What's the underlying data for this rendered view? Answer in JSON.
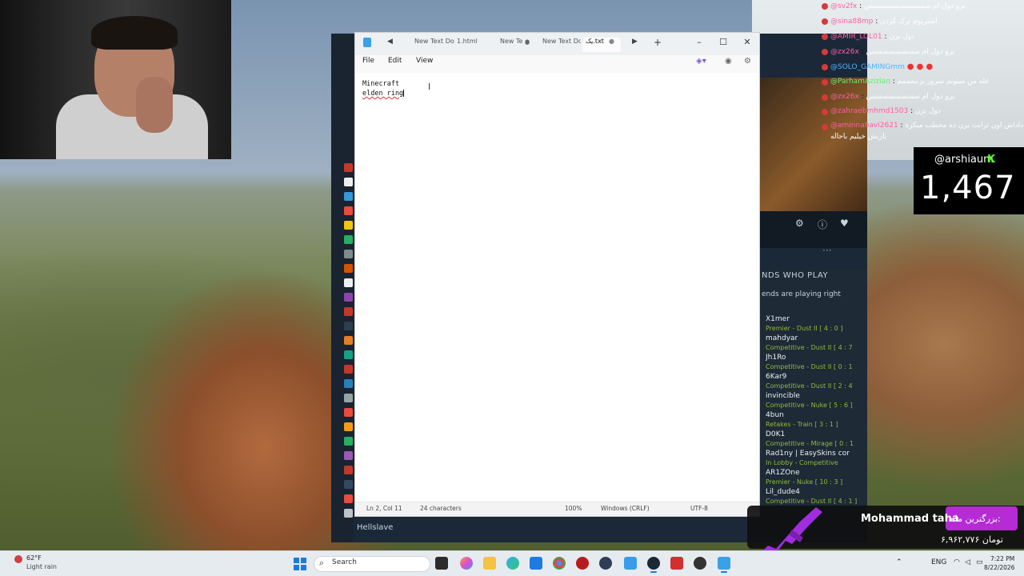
{
  "notepad": {
    "tabs": [
      {
        "label": "New Text Do",
        "modified": false
      },
      {
        "label": "1.html",
        "modified": true
      },
      {
        "label": "New Te",
        "modified": true
      },
      {
        "label": "New Text Do",
        "modified": false
      },
      {
        "label": "یک.txt",
        "modified": true,
        "active": true
      }
    ],
    "add_tab": "+",
    "menu": {
      "file": "File",
      "edit": "Edit",
      "view": "View"
    },
    "lines": [
      "Minecraft",
      "elden ring"
    ],
    "status": {
      "position": "Ln 2, Col 11",
      "characters": "24 characters",
      "zoom": "100%",
      "line_ending": "Windows (CRLF)",
      "encoding": "UTF-8"
    }
  },
  "steam": {
    "friends_title": "NDS WHO PLAY",
    "friends_subtitle": "ends are playing right",
    "bottom_item": "Hellslave",
    "friends": [
      {
        "name": "X1mer",
        "status": "Premier - Dust II [ 4 : 0 ]"
      },
      {
        "name": "mahdyar",
        "status": "Competitive - Dust II [ 4 : 7"
      },
      {
        "name": "Jh1Ro",
        "status": "Competitive - Dust II [ 0 : 1"
      },
      {
        "name": "6Kar9",
        "status": "Competitive - Dust II [ 2 : 4"
      },
      {
        "name": "invincible",
        "status": "Competitive - Nuke [ 5 : 6 ]"
      },
      {
        "name": "4bun",
        "status": "Retakes - Train [ 3 : 1 ]"
      },
      {
        "name": "D0K1",
        "status": "Competitive - Mirage [ 0 : 1"
      },
      {
        "name": "Rad1ny | EasySkins cor",
        "status": "In Lobby - Competitive"
      },
      {
        "name": "AR1ZOne",
        "status": "Premier - Nuke [ 10 : 3 ]"
      },
      {
        "name": "Lil_dude4",
        "status": "Competitive - Dust II [ 4 : 1 ]"
      }
    ]
  },
  "chat": [
    {
      "user": "@sv2fx",
      "msg": "برو دول ام سسسسسسسسسس",
      "color": "#ff5fa2"
    },
    {
      "user": "@sina88mp",
      "msg": "اشتریوم ترک کردن",
      "color": "#ff5fa2"
    },
    {
      "user": "@AMIR_LOL01",
      "msg": "دول بزن",
      "color": "#ff5fa2"
    },
    {
      "user": "@zx26x",
      "msg": "برو دول ام سسسسسسسس",
      "color": "#ff5fa2"
    },
    {
      "user": "@SOLO_GAMINGmm",
      "msg": "",
      "color": "#4fb4ff"
    },
    {
      "user": "@ParhamAzizian",
      "msg": "عله من میتونم سرور بزنیمممم",
      "color": "#63f06f"
    },
    {
      "user": "@zx26x",
      "msg": "برو دول ام سسسسسسسس",
      "color": "#ff5fa2"
    },
    {
      "user": "@zahraebmhmd1503",
      "msg": "دول بزن",
      "color": "#ff5fa2"
    },
    {
      "user": "@aminnabavi2621",
      "msg": "داداش اون ترانت بزن ده مخطب میکره",
      "color": "#ff5fa2"
    },
    {
      "user": "",
      "msg": "بازیش خیلیم باحاله",
      "color": "#ffffff"
    }
  ],
  "counter": {
    "username": "@arshiaum",
    "platform_icon": "K",
    "viewers": "1,467"
  },
  "donation": {
    "donor": "Mohammad taha",
    "title": "بزرگترین ماه:",
    "amount": "۶,۹۶۲,۷۷۶ تومان"
  },
  "taskbar": {
    "weather_temp": "62°F",
    "weather_desc": "Light rain",
    "search_placeholder": "Search",
    "language": "ENG",
    "time": "7:22 PM",
    "date": "8/22/2026"
  },
  "colors": {
    "accent": "#1f7ae0",
    "kick_green": "#53fc18",
    "steam_bg": "#1b2838",
    "status_green": "#90ba3c",
    "donation_purple": "#b52bd4"
  }
}
